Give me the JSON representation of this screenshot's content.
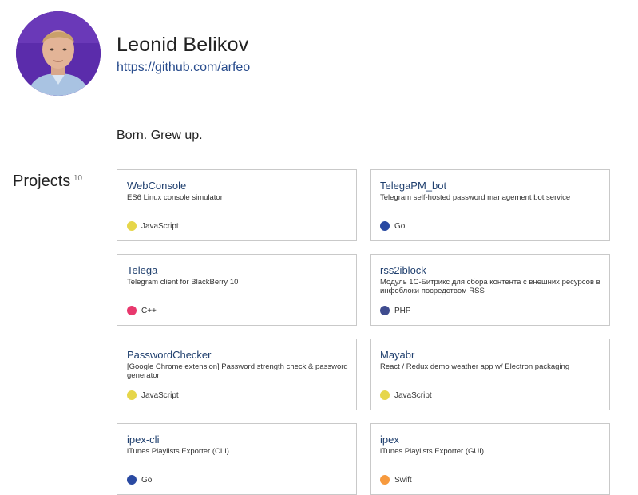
{
  "profile": {
    "name": "Leonid Belikov",
    "github_url": "https://github.com/arfeo",
    "bio": "Born. Grew up."
  },
  "projects": {
    "heading": "Projects",
    "count": "10",
    "items": [
      {
        "title": "WebConsole",
        "description": "ES6 Linux console simulator",
        "language": "JavaScript",
        "color": "#e6d64a"
      },
      {
        "title": "TelegaPM_bot",
        "description": "Telegram self-hosted password management bot service",
        "language": "Go",
        "color": "#2a4aa2"
      },
      {
        "title": "Telega",
        "description": "Telegram client for BlackBerry 10",
        "language": "C++",
        "color": "#e8386d"
      },
      {
        "title": "rss2iblock",
        "description": "Модуль 1С-Битрикс для сбора контента с внешних ресурсов в инфоблоки посредством RSS",
        "language": "PHP",
        "color": "#3f4c8f"
      },
      {
        "title": "PasswordChecker",
        "description": "[Google Chrome extension] Password strength check & password generator",
        "language": "JavaScript",
        "color": "#e6d64a"
      },
      {
        "title": "Mayabr",
        "description": "React / Redux demo weather app w/ Electron packaging",
        "language": "JavaScript",
        "color": "#e6d64a"
      },
      {
        "title": "ipex-cli",
        "description": "iTunes Playlists Exporter (CLI)",
        "language": "Go",
        "color": "#2a4aa2"
      },
      {
        "title": "ipex",
        "description": "iTunes Playlists Exporter (GUI)",
        "language": "Swift",
        "color": "#f79a3e"
      }
    ]
  },
  "colors": {
    "link": "#274b8c",
    "card_title": "#1f3f6e",
    "card_border": "#c9c9c9"
  }
}
